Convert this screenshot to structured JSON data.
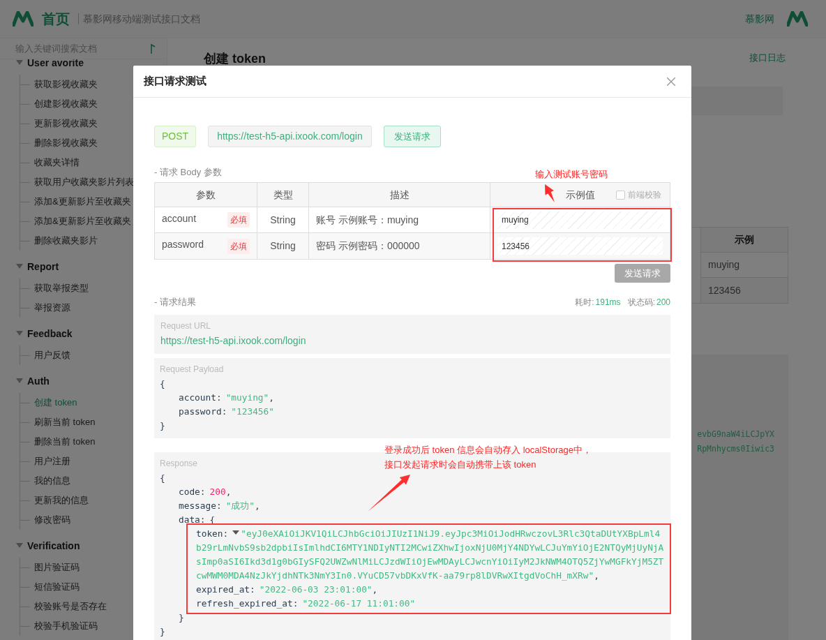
{
  "header": {
    "title": "首页",
    "subtitle": "慕影网移动端测试接口文档",
    "site_name": "慕影网"
  },
  "sidebar": {
    "search_placeholder": "输入关键词搜索文档",
    "groups": [
      {
        "title": "User avorite",
        "expanded": true,
        "items": [
          {
            "label": "获取影视收藏夹",
            "selected": false
          },
          {
            "label": "创建影视收藏夹",
            "selected": false
          },
          {
            "label": "更新影视收藏夹",
            "selected": false
          },
          {
            "label": "删除影视收藏夹",
            "selected": false
          },
          {
            "label": "收藏夹详情",
            "selected": false
          },
          {
            "label": "获取用户收藏夹影片列表",
            "selected": false
          },
          {
            "label": "添加&更新影片至收藏夹",
            "selected": false
          },
          {
            "label": "添加&更新影片至收藏夹",
            "selected": false
          },
          {
            "label": "删除收藏夹影片",
            "selected": false
          }
        ]
      },
      {
        "title": "Report",
        "expanded": true,
        "items": [
          {
            "label": "获取举报类型",
            "selected": false
          },
          {
            "label": "举报资源",
            "selected": false
          }
        ]
      },
      {
        "title": "Feedback",
        "expanded": true,
        "items": [
          {
            "label": "用户反馈",
            "selected": false
          }
        ]
      },
      {
        "title": "Auth",
        "expanded": true,
        "items": [
          {
            "label": "创建 token",
            "selected": true
          },
          {
            "label": "刷新当前 token",
            "selected": false
          },
          {
            "label": "删除当前 token",
            "selected": false
          },
          {
            "label": "用户注册",
            "selected": false
          },
          {
            "label": "我的信息",
            "selected": false
          },
          {
            "label": "更新我的信息",
            "selected": false
          },
          {
            "label": "修改密码",
            "selected": false
          }
        ]
      },
      {
        "title": "Verification",
        "expanded": true,
        "items": [
          {
            "label": "图片验证码",
            "selected": false
          },
          {
            "label": "短信验证码",
            "selected": false
          },
          {
            "label": "校验账号是否存在",
            "selected": false
          },
          {
            "label": "校验手机验证码",
            "selected": false
          }
        ]
      }
    ]
  },
  "page": {
    "title": "创建 token",
    "log_link": "接口日志",
    "example_table": {
      "column": "示例",
      "rows": [
        "muying",
        "123456"
      ]
    },
    "code_fragments": [
      "evbG9naW4iLCJpYX",
      "RpMnhycms0Iiwic3"
    ]
  },
  "dialog": {
    "title": "接口请求测试",
    "method": "POST",
    "url": "https://test-h5-api.ixook.com/login",
    "send_button": "发送请求",
    "body_section": "- 请求 Body 参数",
    "params_table": {
      "columns": [
        "参数",
        "类型",
        "描述",
        "示例值"
      ],
      "validate": {
        "label": "前端校验",
        "checked": false
      },
      "rows": [
        {
          "name": "account",
          "required": "必填",
          "type": "String",
          "description": "账号 示例账号：muying",
          "value": "muying"
        },
        {
          "name": "password",
          "required": "必填",
          "type": "String",
          "description": "密码 示例密码：000000",
          "value": "123456"
        }
      ]
    },
    "submit_button": {
      "label": "发送请求",
      "disabled": true
    },
    "result_section": "- 请求结果",
    "timing": {
      "label": "耗时:",
      "value": "191ms"
    },
    "status": {
      "label": "状态码:",
      "value": "200"
    },
    "request_url": {
      "label": "Request URL",
      "value": "https://test-h5-api.ixook.com/login"
    },
    "request_payload": {
      "label": "Request Payload",
      "body": {
        "open": "{",
        "close": "}",
        "entries": [
          {
            "key": "account:",
            "value": "\"muying\"",
            "kind": "string",
            "trail": ","
          },
          {
            "key": "password:",
            "value": "\"123456\"",
            "kind": "string"
          }
        ]
      }
    },
    "response": {
      "label": "Response",
      "body": {
        "open": "{",
        "close": "}",
        "entries": [
          {
            "key": "code:",
            "value": "200",
            "kind": "number",
            "trail": ","
          },
          {
            "key": "message:",
            "value": "\"成功\"",
            "kind": "string",
            "trail": ","
          },
          {
            "key": "data:",
            "kind": "object",
            "value": {
              "open": "{",
              "close": "}",
              "entries": [
                {
                  "key": "token:",
                  "expanded": true,
                  "kind": "string",
                  "value_lines": [
                    "\"eyJ0eXAiOiJKV1QiLCJhbGciOiJIUzI1NiJ9.eyJpc3MiOiJodHRwczovL3Rlc3QtaDUtYXBpLml4",
                    "b29rLmNvbS9sb2dpbiIsImlhdCI6MTY1NDIyNTI2MCwiZXhwIjoxNjU0MjY4NDYwLCJuYmYiOjE2NTQyMjUyNjA",
                    "sImp0aSI6Ikd3d1g0bGIySFQ2UWZwNlMiLCJzdWIiOjEwMDAyLCJwcnYiOiIyM2JkNWM4OTQ5ZjYwMGFkYjM5ZT",
                    "cwMWM0MDA4NzJkYjdhNTk3NmY3In0.VYuCD57vbDKxVfK-aa79rp8lDVRwXItgdVoChH_mXRw\""
                  ],
                  "trail": ","
                },
                {
                  "key": "expired_at:",
                  "kind": "string",
                  "value": "\"2022-06-03 23:01:00\"",
                  "trail": ","
                },
                {
                  "key": "refresh_expired_at:",
                  "kind": "string",
                  "value": "\"2022-06-17 11:01:00\""
                }
              ]
            }
          }
        ]
      }
    },
    "annotations": [
      {
        "lines": [
          "输入测试账号密码"
        ]
      },
      {
        "lines": [
          "登录成功后 token 信息会自动存入 localStorage中，",
          "接口发起请求时会自动携带上该 token"
        ]
      }
    ]
  }
}
